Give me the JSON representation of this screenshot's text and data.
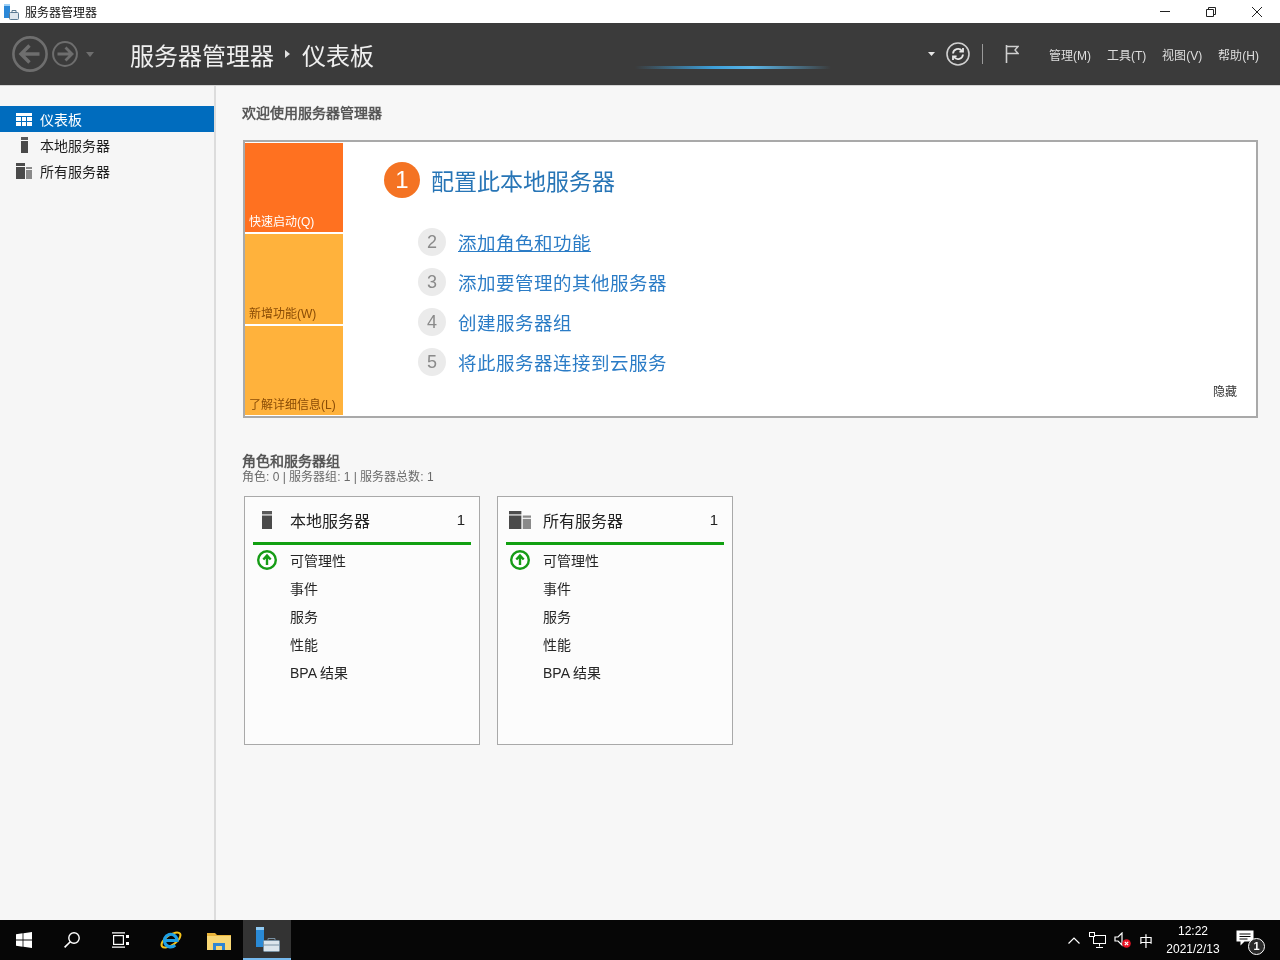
{
  "window": {
    "title": "服务器管理器"
  },
  "header": {
    "nav_disabled": true,
    "breadcrumb": [
      "服务器管理器",
      "仪表板"
    ],
    "menus": [
      "管理(M)",
      "工具(T)",
      "视图(V)",
      "帮助(H)"
    ]
  },
  "sidebar": {
    "items": [
      {
        "kind": "dashboard",
        "label": "仪表板",
        "selected": true
      },
      {
        "kind": "server",
        "label": "本地服务器",
        "selected": false
      },
      {
        "kind": "servers",
        "label": "所有服务器",
        "selected": false
      }
    ]
  },
  "welcome": {
    "heading": "欢迎使用服务器管理器",
    "tiles": [
      {
        "label": "快速启动(Q)",
        "selected": true
      },
      {
        "label": "新增功能(W)",
        "selected": false
      },
      {
        "label": "了解详细信息(L)",
        "selected": false
      }
    ],
    "steps": [
      {
        "kind": "primary",
        "number": "1",
        "label": "配置此本地服务器",
        "hovered": false
      },
      {
        "kind": "link",
        "number": "2",
        "label": "添加角色和功能",
        "hovered": true
      },
      {
        "kind": "link",
        "number": "3",
        "label": "添加要管理的其他服务器",
        "hovered": false
      },
      {
        "kind": "link",
        "number": "4",
        "label": "创建服务器组",
        "hovered": false
      },
      {
        "kind": "link",
        "number": "5",
        "label": "将此服务器连接到云服务",
        "hovered": false
      }
    ],
    "hide": "隐藏"
  },
  "roles": {
    "heading": "角色和服务器组",
    "summary": "角色: 0 | 服务器组: 1 | 服务器总数: 1",
    "cards": [
      {
        "kind": "server",
        "title": "本地服务器",
        "count": "1",
        "healthy": true,
        "items": [
          {
            "label": "可管理性",
            "ok": true
          },
          {
            "label": "事件",
            "ok": false
          },
          {
            "label": "服务",
            "ok": false
          },
          {
            "label": "性能",
            "ok": false
          },
          {
            "label": "BPA 结果",
            "ok": false
          }
        ]
      },
      {
        "kind": "servers",
        "title": "所有服务器",
        "count": "1",
        "healthy": true,
        "items": [
          {
            "label": "可管理性",
            "ok": true
          },
          {
            "label": "事件",
            "ok": false
          },
          {
            "label": "服务",
            "ok": false
          },
          {
            "label": "性能",
            "ok": false
          },
          {
            "label": "BPA 结果",
            "ok": false
          }
        ]
      }
    ]
  },
  "taskbar": {
    "apps": [
      {
        "kind": "browser",
        "selected": false
      },
      {
        "kind": "file-explorer",
        "selected": false
      },
      {
        "kind": "server-manager",
        "selected": true
      }
    ],
    "tray": {
      "volume_muted": true,
      "ime": "中",
      "time": "12:22",
      "date": "2021/2/13",
      "notifications": "1"
    }
  }
}
